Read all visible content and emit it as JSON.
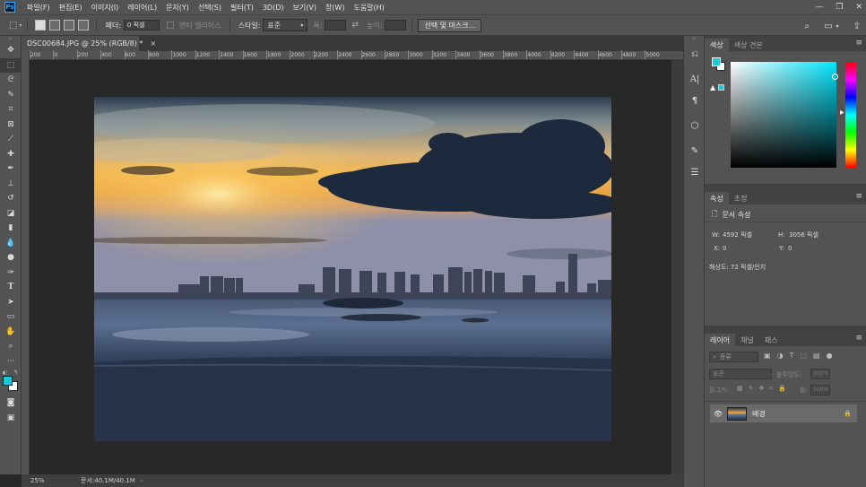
{
  "menubar": {
    "logo": "Ps",
    "items": [
      "파일(F)",
      "편집(E)",
      "이미지(I)",
      "레이어(L)",
      "문자(Y)",
      "선택(S)",
      "필터(T)",
      "3D(D)",
      "보기(V)",
      "창(W)",
      "도움말(H)"
    ]
  },
  "options": {
    "feather_label": "페더:",
    "feather_value": "0 픽셀",
    "antialias_label": "앤티 앨리어스",
    "style_label": "스타일:",
    "style_value": "표준",
    "width_label": "폭:",
    "height_label": "높이:",
    "select_mask_button": "선택 및 마스크..."
  },
  "document": {
    "tab_title": "DSC00684.JPG @ 25% (RGB/8) *",
    "close_glyph": "×"
  },
  "ruler": {
    "h_ticks": [
      "200",
      "0",
      "200",
      "400",
      "600",
      "800",
      "1000",
      "1200",
      "1400",
      "1600",
      "1800",
      "2000",
      "2200",
      "2400",
      "2600",
      "2800",
      "3000",
      "3200",
      "3400",
      "3600",
      "3800",
      "4000",
      "4200",
      "4400",
      "4600",
      "4800",
      "5000"
    ]
  },
  "status": {
    "zoom": "25%",
    "doc_size": "문서:40.1M/40.1M"
  },
  "color_panel": {
    "tabs": [
      "색상",
      "색상 견본"
    ],
    "fg_color": "#1ec8d6",
    "bg_color": "#ffffff"
  },
  "properties_panel": {
    "tabs": [
      "속성",
      "조정"
    ],
    "section_title": "문서 속성",
    "w_label": "W:",
    "w_value": "4592 픽셀",
    "h_label": "H:",
    "h_value": "3056 픽셀",
    "x_label": "X:",
    "x_value": "0",
    "y_label": "Y:",
    "y_value": "0",
    "resolution": "해상도: 72 픽셀/인치"
  },
  "layers_panel": {
    "tabs": [
      "레이어",
      "채널",
      "패스"
    ],
    "filter_placeholder": "종류",
    "blend_mode": "표준",
    "opacity_label": "불투명도:",
    "opacity_value": "100%",
    "lock_label": "잠그기:",
    "fill_label": "칠:",
    "fill_value": "100%",
    "layers": [
      {
        "name": "배경"
      }
    ]
  }
}
